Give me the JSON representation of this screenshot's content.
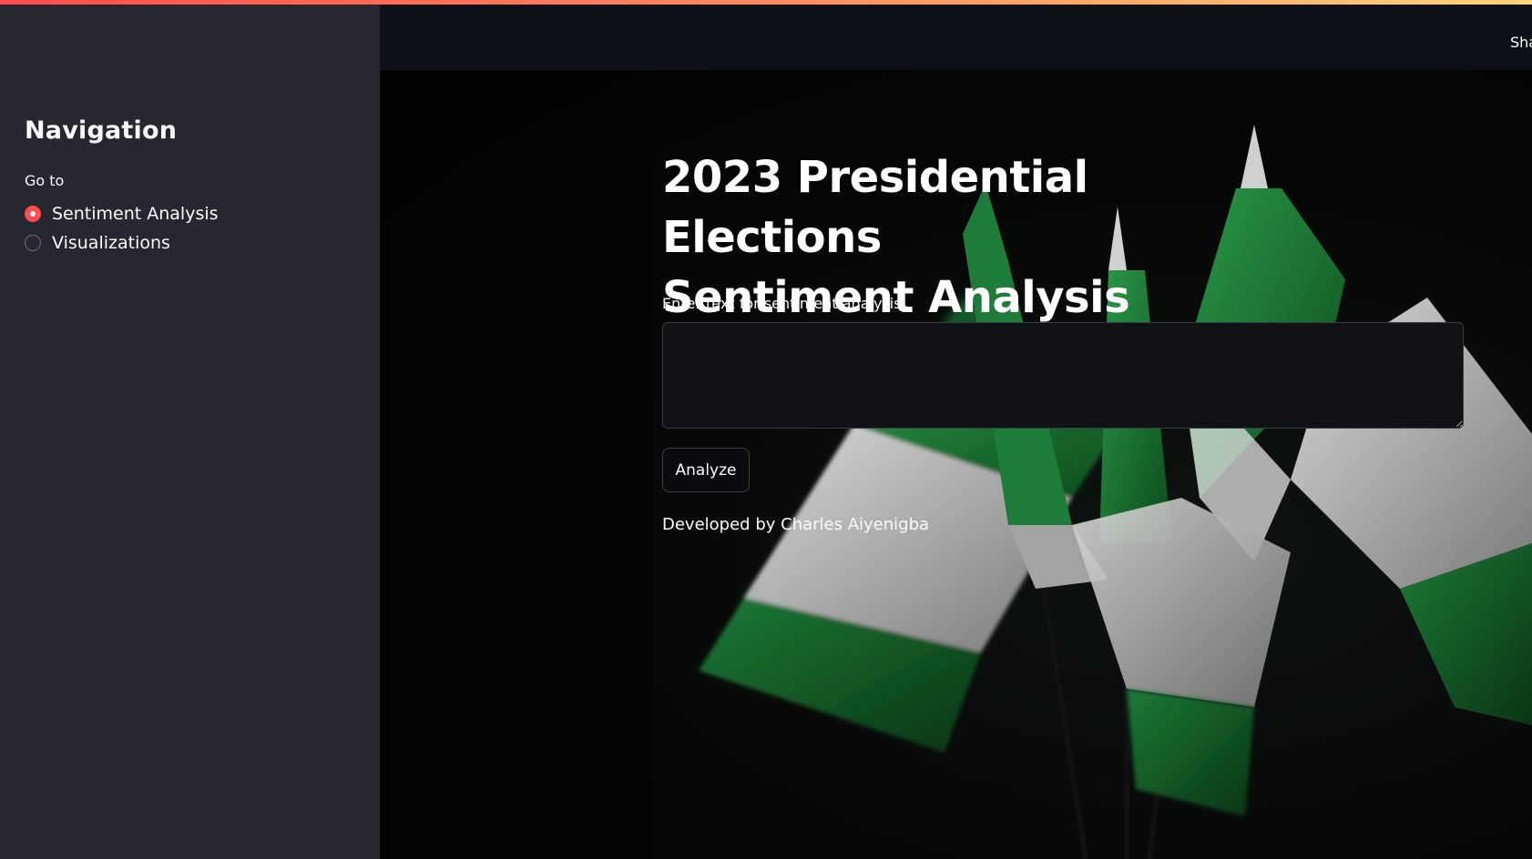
{
  "sidebar": {
    "heading": "Navigation",
    "radio_label": "Go to",
    "options": [
      {
        "label": "Sentiment Analysis",
        "selected": true
      },
      {
        "label": "Visualizations",
        "selected": false
      }
    ]
  },
  "header": {
    "share_label": "Sha"
  },
  "main": {
    "title_line1": "2023 Presidential Elections",
    "title_line2": "Sentiment Analysis",
    "input_label": "Enter text for sentiment analysis:",
    "input_value": "",
    "analyze_button": "Analyze",
    "credit": "Developed by Charles Aiyenigba"
  },
  "colors": {
    "accent": "#ff4b4b",
    "sidebar_bg": "#262730",
    "header_bg": "#0e1117",
    "flag_green": "#1f7a36",
    "flag_white": "#cfcfcf"
  },
  "background_image": {
    "icon": "nigeria-flags-image"
  }
}
